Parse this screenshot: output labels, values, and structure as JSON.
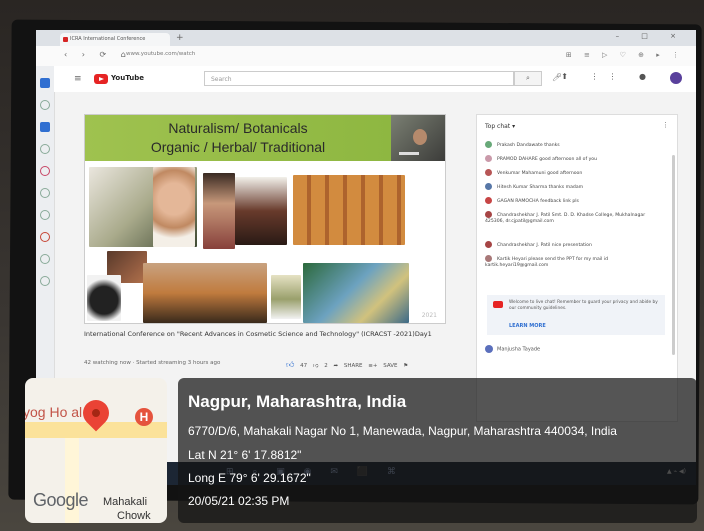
{
  "browser": {
    "tab_title": "ICRA International Conference",
    "url": "www.youtube.com/watch",
    "nav_glyphs": "‹ › ⟳ ⌂",
    "addr_icons": "⊞ ≡ ▷ ♡ ⊕ ▸ ⋮",
    "window_controls": "– □ ×"
  },
  "youtube": {
    "brand": "YouTube",
    "search_placeholder": "Search"
  },
  "slide": {
    "title_line1": "Naturalism/ Botanicals",
    "title_line2": "Organic / Herbal/ Traditional"
  },
  "video": {
    "title": "International Conference on \"Recent Advances in Cosmetic Science and Technology\" (ICRACST -2021)Day1",
    "meta": "42 watching now · Started streaming 3 hours ago",
    "likes": "47",
    "dislikes": "2",
    "share": "SHARE",
    "save": "SAVE"
  },
  "chat": {
    "header": "Top chat ▾",
    "messages": [
      "Prakash Dandawate  thanks",
      "PRAMOD DAHARE  good afternoon all of you",
      "Venkumar Mahamuni  good afternoon",
      "Hitesh Kumar Sharma  thanks madam",
      "GAGAN RAMOCHA  feedback link pls",
      "Chandrashekhar J. Patil  Smt. D. D. Khadse College, Mukhalnagar 425306, dr.cjpatil@gmail.com",
      "Chandrashekhar J. Patil  nice presentation",
      "Kartik Heyari  please send the PPT for my mail id kartik.heyari19@gmail.com"
    ],
    "notice": "Welcome to live chat! Remember to guard your privacy and abide by our community guidelines.",
    "learn_more": "LEARN MORE",
    "last_user": "Manjusha Tayade"
  },
  "overlay": {
    "map": {
      "place_label": "yog Ho      al",
      "hospital_badge": "H",
      "google": "Google",
      "mahakali": "Mahakali",
      "chowk": "Chowk"
    },
    "location_title": "Nagpur, Maharashtra, India",
    "address": "6770/D/6, Mahakali Nagar No 1, Manewada, Nagpur, Maharashtra 440034, India",
    "lat": "Lat N 21° 6' 17.8812\"",
    "long": "Long E 79° 6' 29.1672\"",
    "datetime": "20/05/21 02:35 PM"
  },
  "colors": {
    "slide_green": "#9ec34a",
    "youtube_red": "#e22222",
    "pin_red": "#ea4335"
  }
}
